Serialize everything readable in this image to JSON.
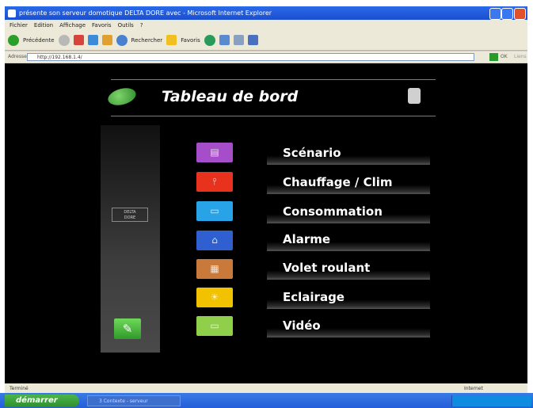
{
  "window": {
    "title": "présente son serveur domotique DELTA DORE avec - Microsoft Internet Explorer"
  },
  "menubar": [
    "Fichier",
    "Edition",
    "Affichage",
    "Favoris",
    "Outils",
    "?"
  ],
  "toolbar": {
    "back_label": "Précédente",
    "search_label": "Rechercher",
    "favorites_label": "Favoris"
  },
  "address": {
    "label": "Adresse",
    "value": "http://192.168.1.4/",
    "go_label": "OK",
    "links_label": "Liens"
  },
  "app": {
    "title": "Tableau de bord",
    "brand_line1": "DELTA",
    "brand_line2": "DORE",
    "menu": [
      {
        "label": "Scénario",
        "icon": "scenario-icon",
        "color": "#a64dc9"
      },
      {
        "label": "Chauffage / Clim",
        "icon": "thermometer-icon",
        "color": "#e8321e"
      },
      {
        "label": "Consommation",
        "icon": "chart-icon",
        "color": "#29a3e8"
      },
      {
        "label": "Alarme",
        "icon": "house-alarm-icon",
        "color": "#2f5fd0"
      },
      {
        "label": "Volet roulant",
        "icon": "shutter-icon",
        "color": "#c97a3a"
      },
      {
        "label": "Eclairage",
        "icon": "bulb-icon",
        "color": "#f2c200"
      },
      {
        "label": "Vidéo",
        "icon": "video-icon",
        "color": "#8fcf4a"
      }
    ],
    "settings_icon": "wrench-icon"
  },
  "statusbar": {
    "left_text": "Terminé",
    "zone_text": "Internet"
  },
  "taskbar": {
    "start_label": "démarrer",
    "task_label": "3 Contexte - serveur"
  }
}
